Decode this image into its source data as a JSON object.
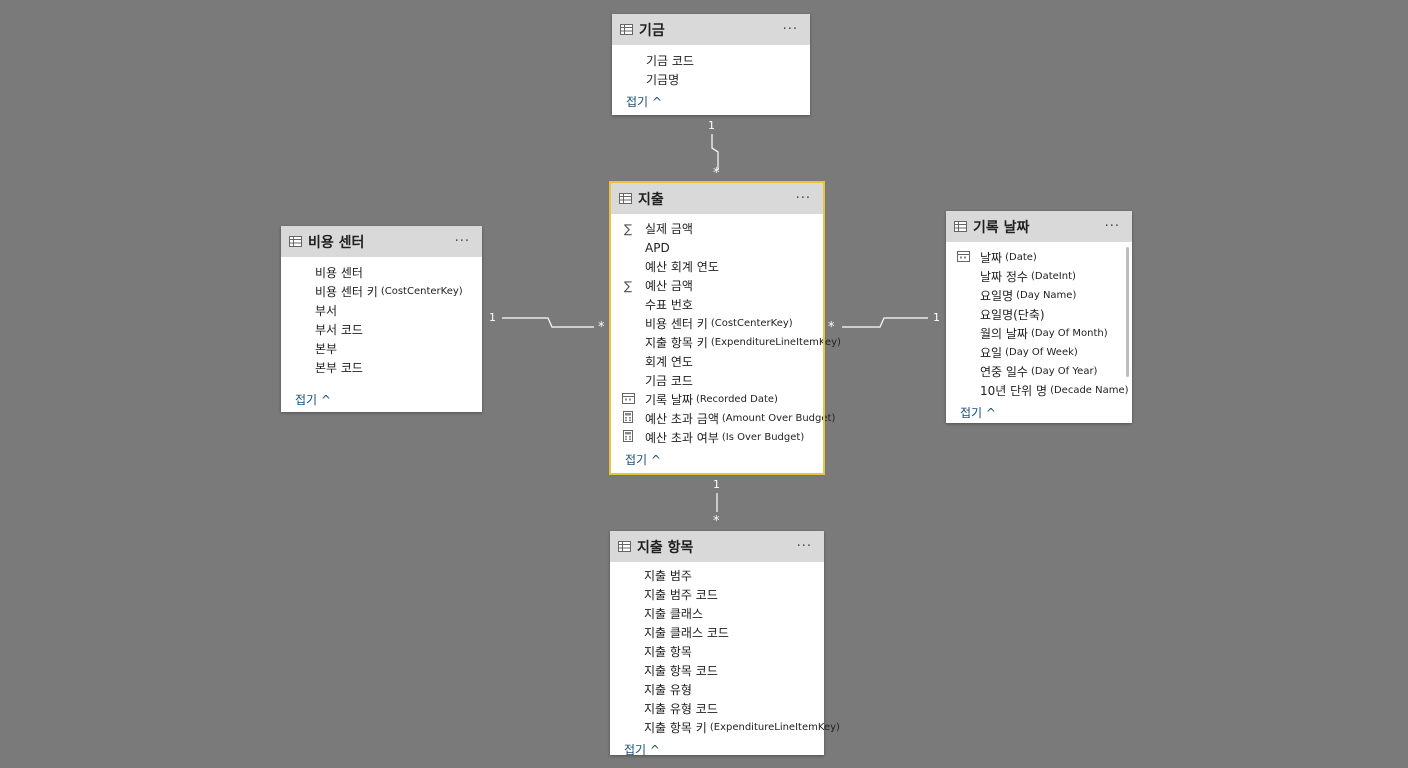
{
  "tables": {
    "fund": {
      "title": "기금",
      "more": "···",
      "fields": [
        "기금 코드",
        "기금명"
      ],
      "collapse": "접기 ^"
    },
    "expense": {
      "title": "지출",
      "more": "···",
      "fields": [
        {
          "name": "실제 금액",
          "en": "",
          "icon": "sigma"
        },
        {
          "name": "APD",
          "en": "",
          "icon": ""
        },
        {
          "name": "예산 회계 연도",
          "en": "",
          "icon": ""
        },
        {
          "name": "예산 금액",
          "en": "",
          "icon": "sigma"
        },
        {
          "name": "수표 번호",
          "en": "",
          "icon": ""
        },
        {
          "name": "비용 센터 키",
          "en": "(CostCenterKey)",
          "icon": ""
        },
        {
          "name": "지출 항목 키",
          "en": "(ExpenditureLineItemKey)",
          "icon": ""
        },
        {
          "name": "회계 연도",
          "en": "",
          "icon": ""
        },
        {
          "name": "기금 코드",
          "en": "",
          "icon": ""
        },
        {
          "name": "기록 날짜",
          "en": "(Recorded Date)",
          "icon": "calendar"
        },
        {
          "name": "예산 초과 금액",
          "en": "(Amount Over Budget)",
          "icon": "calc"
        },
        {
          "name": "예산 초과 여부",
          "en": "(Is Over Budget)",
          "icon": "calc"
        }
      ],
      "collapse": "접기 ^"
    },
    "costcenter": {
      "title": "비용 센터",
      "more": "···",
      "fields": [
        {
          "name": "비용 센터",
          "en": ""
        },
        {
          "name": "비용 센터 키",
          "en": "(CostCenterKey)"
        },
        {
          "name": "부서",
          "en": ""
        },
        {
          "name": "부서 코드",
          "en": ""
        },
        {
          "name": "본부",
          "en": ""
        },
        {
          "name": "본부 코드",
          "en": ""
        }
      ],
      "collapse": "접기 ^"
    },
    "recorddate": {
      "title": "기록 날짜",
      "more": "···",
      "fields": [
        {
          "name": "날짜",
          "en": "(Date)",
          "icon": "calendar"
        },
        {
          "name": "날짜 정수",
          "en": "(DateInt)",
          "icon": ""
        },
        {
          "name": "요일명",
          "en": "(Day Name)",
          "icon": ""
        },
        {
          "name": "요일명(단축)",
          "en": "",
          "icon": ""
        },
        {
          "name": "월의 날짜",
          "en": "(Day Of Month)",
          "icon": ""
        },
        {
          "name": "요일",
          "en": "(Day Of Week)",
          "icon": ""
        },
        {
          "name": "연중 일수",
          "en": "(Day Of Year)",
          "icon": ""
        },
        {
          "name": "10년 단위 명",
          "en": "(Decade Name)",
          "icon": ""
        }
      ],
      "collapse": "접기 ^"
    },
    "lineitem": {
      "title": "지출 항목",
      "more": "···",
      "fields": [
        {
          "name": "지출 범주",
          "en": ""
        },
        {
          "name": "지출 범주 코드",
          "en": ""
        },
        {
          "name": "지출 클래스",
          "en": ""
        },
        {
          "name": "지출 클래스 코드",
          "en": ""
        },
        {
          "name": "지출 항목",
          "en": ""
        },
        {
          "name": "지출 항목 코드",
          "en": ""
        },
        {
          "name": "지출 유형",
          "en": ""
        },
        {
          "name": "지출 유형 코드",
          "en": ""
        },
        {
          "name": "지출 항목 키",
          "en": "(ExpenditureLineItemKey)"
        }
      ],
      "collapse": "접기 ^"
    }
  },
  "relationships": {
    "fund_expense": {
      "one": "1",
      "many": "*"
    },
    "costcenter_expense": {
      "one": "1",
      "many": "*"
    },
    "recorddate_expense": {
      "one": "1",
      "many": "*"
    },
    "lineitem_expense": {
      "one": "1",
      "many": "*"
    }
  },
  "colors": {
    "canvas": "#7a7a7a",
    "header": "#d9d9d9",
    "selected": "#e8c540",
    "link": "#1a4f7a"
  }
}
